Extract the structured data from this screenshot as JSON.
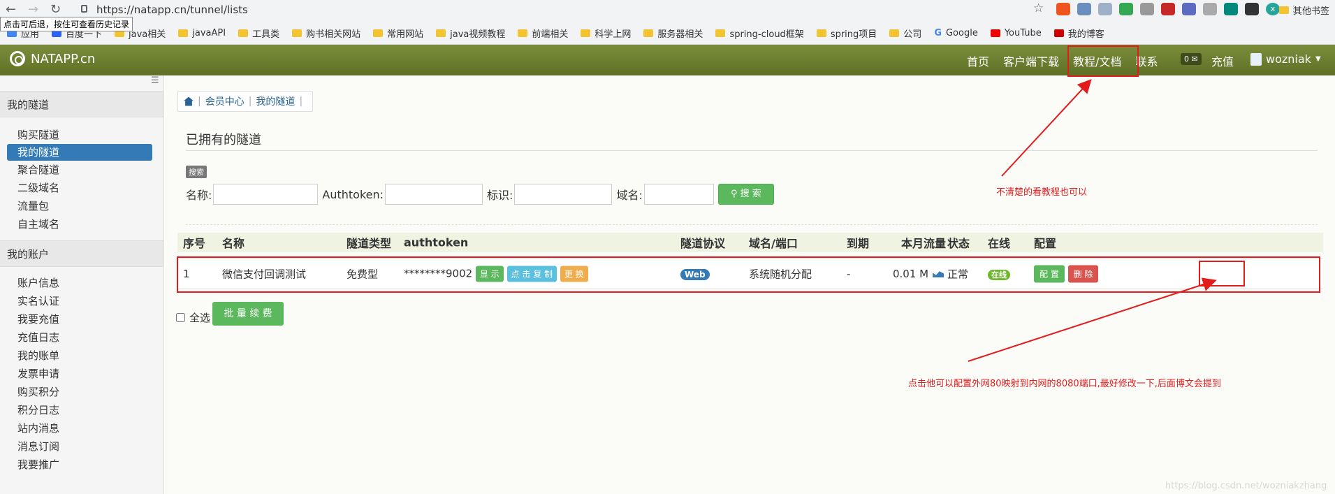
{
  "browser": {
    "url": "https://natapp.cn/tunnel/lists",
    "tooltip": "点击可后退，按住可查看历史记录",
    "bookmarks": [
      "应用",
      "百度一下",
      "java相关",
      "javaAPI",
      "工具类",
      "购书相关网站",
      "常用网站",
      "java视频教程",
      "前端相关",
      "科学上网",
      "服务器相关",
      "spring-cloud框架",
      "spring项目",
      "公司",
      "Google",
      "YouTube",
      "我的博客"
    ],
    "other_bookmarks": "其他书签"
  },
  "topbar": {
    "logo": "NATAPP.cn",
    "nav": [
      "首页",
      "客户端下载",
      "教程/文档",
      "联系"
    ],
    "msg_count": "0",
    "recharge": "充值",
    "user": "wozniak"
  },
  "sidebar": {
    "tunnel_header": "我的隧道",
    "tunnel_items": [
      "购买隧道",
      "我的隧道",
      "聚合隧道",
      "二级域名",
      "流量包",
      "自主域名"
    ],
    "account_header": "我的账户",
    "account_items": [
      "账户信息",
      "实名认证",
      "我要充值",
      "充值日志",
      "我的账单",
      "发票申请",
      "购买积分",
      "积分日志",
      "站内消息",
      "消息订阅",
      "我要推广"
    ]
  },
  "breadcrumb": [
    "会员中心",
    "我的隧道"
  ],
  "page_title": "已拥有的隧道",
  "search": {
    "label": "搜索",
    "name_label": "名称:",
    "token_label": "Authtoken:",
    "id_label": "标识:",
    "domain_label": "域名:",
    "button": "搜 索"
  },
  "table": {
    "headers": [
      "序号",
      "名称",
      "隧道类型",
      "authtoken",
      "隧道协议",
      "域名/端口",
      "到期",
      "本月流量",
      "状态",
      "在线",
      "配置"
    ],
    "row": {
      "index": "1",
      "name": "微信支付回调测试",
      "type": "免费型",
      "token": "********9002",
      "show": "显 示",
      "copy": "点 击 复 制",
      "change": "更 换",
      "protocol": "Web",
      "domain": "系统随机分配",
      "expire": "-",
      "traffic": "0.01 M",
      "status": "正常",
      "online": "在线",
      "config": "配 置",
      "delete": "删 除"
    }
  },
  "footer": {
    "select_all": "全选",
    "renew": "批 量 续 费"
  },
  "annotations": {
    "note1": "不清楚的看教程也可以",
    "note2": "点击他可以配置外网80映射到内网的8080端口,最好修改一下,后面博文会提到"
  },
  "watermark": "https://blog.csdn.net/wozniakzhang"
}
